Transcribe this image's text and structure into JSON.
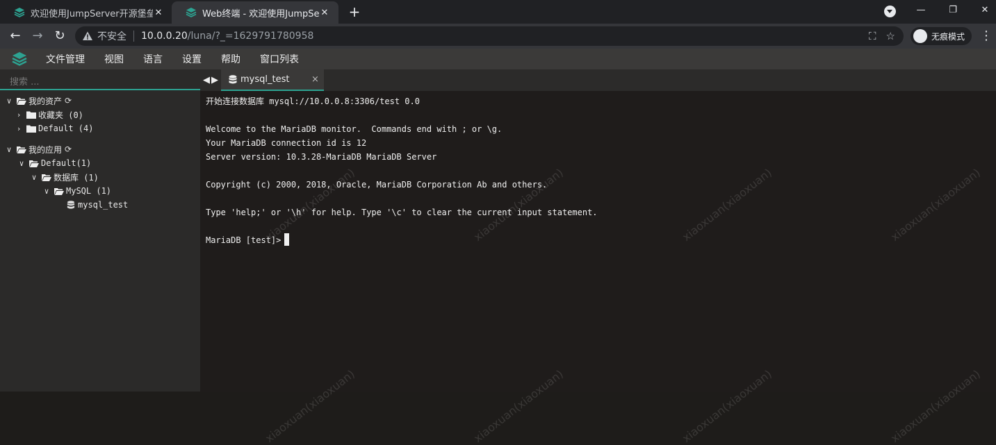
{
  "browser": {
    "tabs": [
      {
        "title": "欢迎使用JumpServer开源堡垒机",
        "active": false
      },
      {
        "title": "Web终端 - 欢迎使用JumpServer开源堡垒机",
        "active": true
      }
    ],
    "new_tab_symbol": "+",
    "window_controls": {
      "minimize": "—",
      "maximize": "❐",
      "close": "✕"
    },
    "nav": {
      "back": "←",
      "forward": "→",
      "reload": "↻"
    },
    "address": {
      "security_label": "不安全",
      "host": "10.0.0.20",
      "path": "/luna/?_=1629791780958"
    },
    "omnibox_icons": [
      "translate-icon",
      "star-icon"
    ],
    "incognito_label": "无痕模式",
    "menu_symbol": "⋮"
  },
  "app": {
    "menu": [
      "文件管理",
      "视图",
      "语言",
      "设置",
      "帮助",
      "窗口列表"
    ],
    "brand_color": "#2da291"
  },
  "sidebar": {
    "search_placeholder": "搜索 ...",
    "tree": {
      "assets_root": "我的资产",
      "favorites": "收藏夹 (0)",
      "default_assets": "Default (4)",
      "apps_root": "我的应用",
      "default_apps": "Default(1)",
      "databases": "数据库 (1)",
      "mysql_group": "MySQL (1)",
      "mysql_item": "mysql_test"
    }
  },
  "terminal": {
    "tab_title": "mysql_test",
    "tab_close": "×",
    "lines": [
      "开始连接数据库 mysql://10.0.0.8:3306/test 0.0",
      "",
      "Welcome to the MariaDB monitor.  Commands end with ; or \\g.",
      "Your MariaDB connection id is 12",
      "Server version: 10.3.28-MariaDB MariaDB Server",
      "",
      "Copyright (c) 2000, 2018, Oracle, MariaDB Corporation Ab and others.",
      "",
      "Type 'help;' or '\\h' for help. Type '\\c' to clear the current input statement.",
      ""
    ],
    "prompt": "MariaDB [test]>",
    "watermark": "xiaoxuan(xiaoxuan)"
  }
}
